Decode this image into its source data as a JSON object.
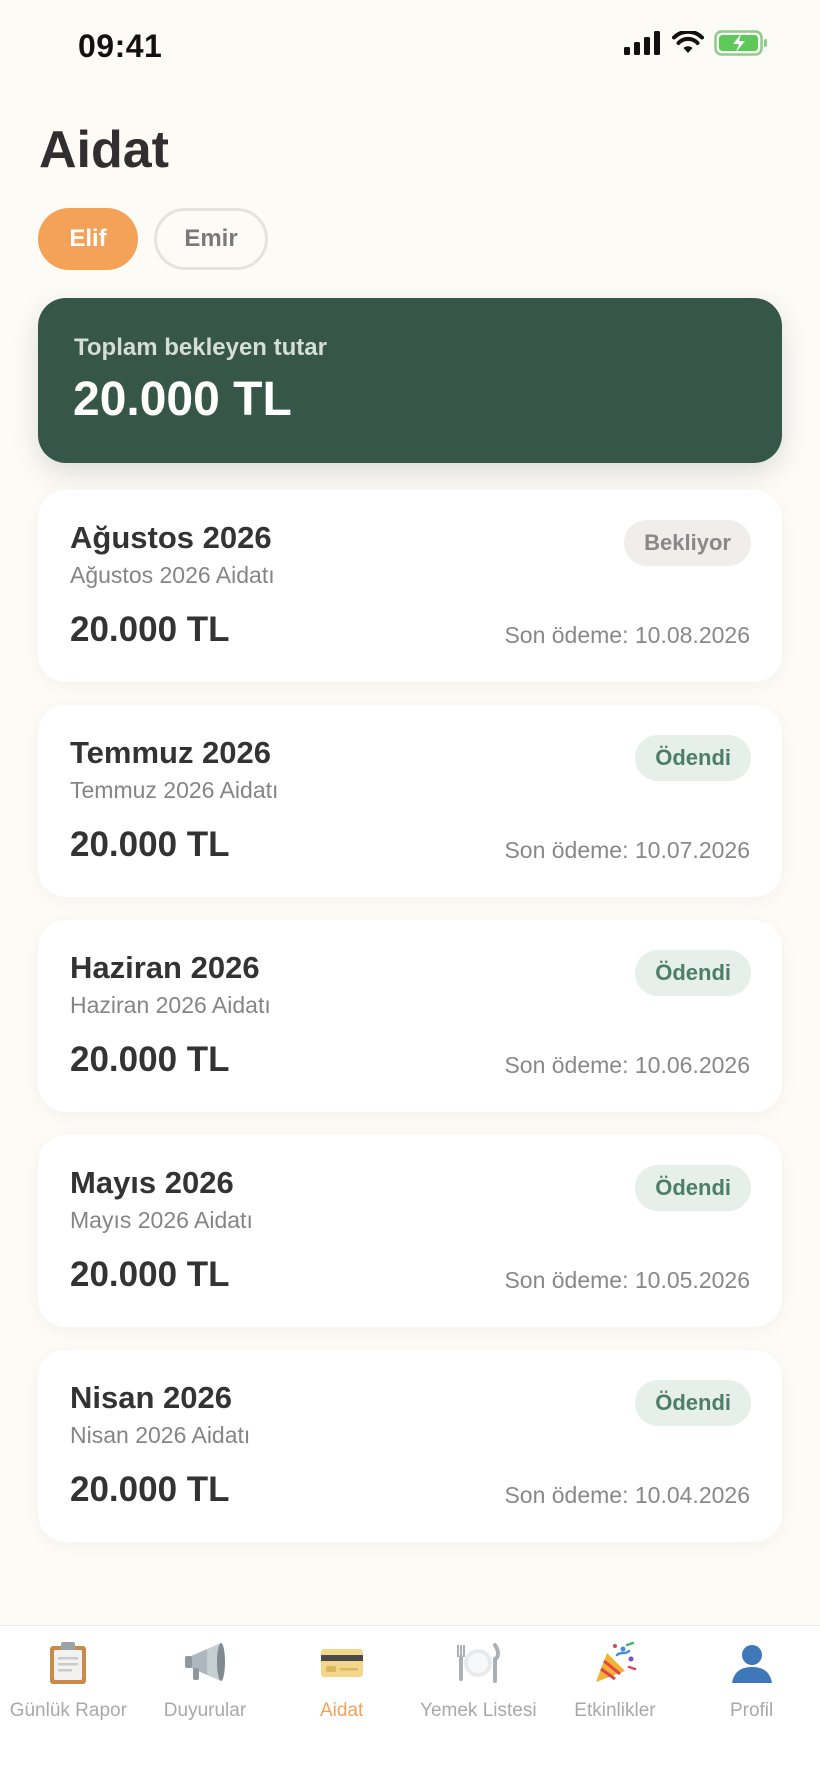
{
  "status_bar": {
    "time": "09:41"
  },
  "header": {
    "title": "Aidat"
  },
  "children": [
    {
      "name": "Elif",
      "active": true
    },
    {
      "name": "Emir",
      "active": false
    }
  ],
  "summary": {
    "label": "Toplam bekleyen tutar",
    "amount": "20.000 TL"
  },
  "dues": [
    {
      "title": "Ağustos 2026",
      "subtitle": "Ağustos 2026 Aidatı",
      "amount": "20.000 TL",
      "deadline": "Son ödeme: 10.08.2026",
      "status": "Bekliyor",
      "status_type": "pending"
    },
    {
      "title": "Temmuz 2026",
      "subtitle": "Temmuz 2026 Aidatı",
      "amount": "20.000 TL",
      "deadline": "Son ödeme: 10.07.2026",
      "status": "Ödendi",
      "status_type": "paid"
    },
    {
      "title": "Haziran 2026",
      "subtitle": "Haziran 2026 Aidatı",
      "amount": "20.000 TL",
      "deadline": "Son ödeme: 10.06.2026",
      "status": "Ödendi",
      "status_type": "paid"
    },
    {
      "title": "Mayıs 2026",
      "subtitle": "Mayıs 2026 Aidatı",
      "amount": "20.000 TL",
      "deadline": "Son ödeme: 10.05.2026",
      "status": "Ödendi",
      "status_type": "paid"
    },
    {
      "title": "Nisan 2026",
      "subtitle": "Nisan 2026 Aidatı",
      "amount": "20.000 TL",
      "deadline": "Son ödeme: 10.04.2026",
      "status": "Ödendi",
      "status_type": "paid"
    }
  ],
  "tabs": [
    {
      "label": "Günlük Rapor",
      "icon": "clipboard-icon",
      "active": false
    },
    {
      "label": "Duyurular",
      "icon": "megaphone-icon",
      "active": false
    },
    {
      "label": "Aidat",
      "icon": "credit-card-icon",
      "active": true
    },
    {
      "label": "Yemek Listesi",
      "icon": "plate-icon",
      "active": false
    },
    {
      "label": "Etkinlikler",
      "icon": "party-popper-icon",
      "active": false
    },
    {
      "label": "Profil",
      "icon": "user-icon",
      "active": false
    }
  ],
  "colors": {
    "accent": "#F4A258",
    "summary_bg": "#355649",
    "paid_text": "#4C7E68",
    "paid_bg": "#E6EFEA",
    "pending_bg": "#EFEEEA",
    "background": "#FCFBF6"
  }
}
